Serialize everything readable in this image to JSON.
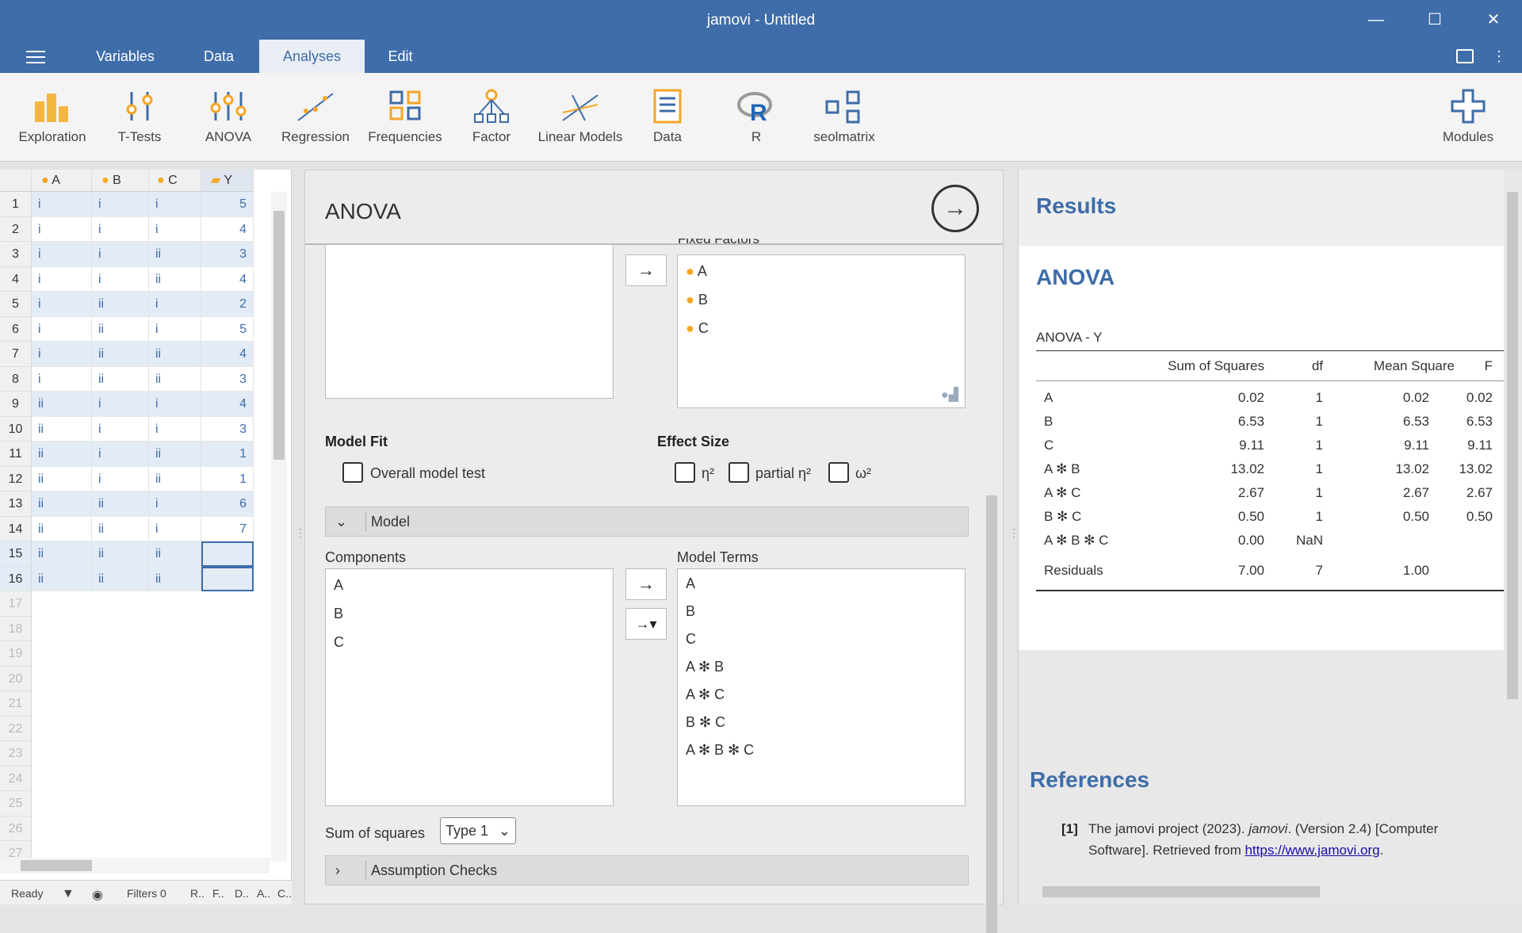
{
  "window": {
    "title": "jamovi - Untitled"
  },
  "menu": {
    "tabs": [
      "Variables",
      "Data",
      "Analyses",
      "Edit"
    ],
    "active": "Analyses"
  },
  "ribbon": {
    "items": [
      "Exploration",
      "T-Tests",
      "ANOVA",
      "Regression",
      "Frequencies",
      "Factor",
      "Linear Models",
      "Data",
      "R",
      "seolmatrix"
    ],
    "modules": "Modules"
  },
  "sheet": {
    "columns": [
      "A",
      "B",
      "C",
      "Y"
    ],
    "rows": [
      [
        "i",
        "i",
        "i",
        "5"
      ],
      [
        "i",
        "i",
        "i",
        "4"
      ],
      [
        "i",
        "i",
        "ii",
        "3"
      ],
      [
        "i",
        "i",
        "ii",
        "4"
      ],
      [
        "i",
        "ii",
        "i",
        "2"
      ],
      [
        "i",
        "ii",
        "i",
        "5"
      ],
      [
        "i",
        "ii",
        "ii",
        "4"
      ],
      [
        "i",
        "ii",
        "ii",
        "3"
      ],
      [
        "ii",
        "i",
        "i",
        "4"
      ],
      [
        "ii",
        "i",
        "i",
        "3"
      ],
      [
        "ii",
        "i",
        "ii",
        "1"
      ],
      [
        "ii",
        "i",
        "ii",
        "1"
      ],
      [
        "ii",
        "ii",
        "i",
        "6"
      ],
      [
        "ii",
        "ii",
        "i",
        "7"
      ],
      [
        "ii",
        "ii",
        "ii",
        ""
      ],
      [
        "ii",
        "ii",
        "ii",
        ""
      ]
    ],
    "empty_rows": [
      "17",
      "18",
      "19",
      "20",
      "21",
      "22",
      "23",
      "24",
      "25",
      "26",
      "27"
    ]
  },
  "status": {
    "ready": "Ready",
    "filters": "Filters 0",
    "tags": [
      "R..",
      "F..",
      "D..",
      "A..",
      "C.."
    ]
  },
  "panel": {
    "title": "ANOVA",
    "fixed_factors_label": "Fixed Factors",
    "fixed_factors": [
      "A",
      "B",
      "C"
    ],
    "model_fit": {
      "heading": "Model Fit",
      "overall": "Overall model test"
    },
    "effect_size": {
      "heading": "Effect Size",
      "eta": "η²",
      "partial_eta": "partial η²",
      "omega": "ω²"
    },
    "model_section": "Model",
    "components_label": "Components",
    "components": [
      "A",
      "B",
      "C"
    ],
    "model_terms_label": "Model Terms",
    "model_terms": [
      "A",
      "B",
      "C",
      "A ✻ B",
      "A ✻ C",
      "B ✻ C",
      "A ✻ B ✻ C"
    ],
    "ss_label": "Sum of squares",
    "ss_value": "Type 1",
    "assumption": "Assumption Checks"
  },
  "results": {
    "header": "Results",
    "anova_title": "ANOVA",
    "table_caption": "ANOVA - Y",
    "columns": [
      "Sum of Squares",
      "df",
      "Mean Square",
      "F"
    ],
    "rows": [
      [
        "A",
        "0.02",
        "1",
        "0.02",
        "0.02"
      ],
      [
        "B",
        "6.53",
        "1",
        "6.53",
        "6.53"
      ],
      [
        "C",
        "9.11",
        "1",
        "9.11",
        "9.11"
      ],
      [
        "A ✻ B",
        "13.02",
        "1",
        "13.02",
        "13.02"
      ],
      [
        "A ✻ C",
        "2.67",
        "1",
        "2.67",
        "2.67"
      ],
      [
        "B ✻ C",
        "0.50",
        "1",
        "0.50",
        "0.50"
      ],
      [
        "A ✻ B ✻ C",
        "0.00",
        "NaN",
        "",
        ""
      ],
      [
        "Residuals",
        "7.00",
        "7",
        "1.00",
        ""
      ]
    ],
    "references_title": "References",
    "ref_num": "[1]",
    "ref_a": "The jamovi project (2023). ",
    "ref_i": "jamovi",
    "ref_b": ". (Version 2.4) [Computer Software]. Retrieved from ",
    "ref_link": "https://www.jamovi.org",
    "ref_end": "."
  }
}
